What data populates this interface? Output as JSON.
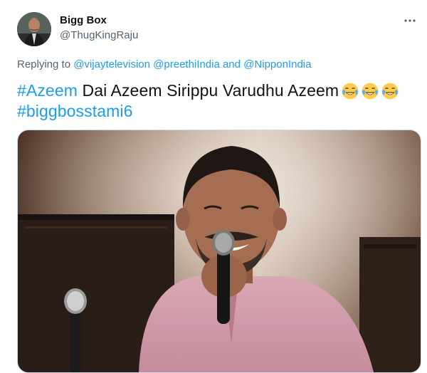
{
  "tweet": {
    "author_name": "Bigg Box",
    "author_handle": "@ThugKingRaju",
    "replying_to_label": "Replying to",
    "mention_1": "@vijaytelevision",
    "mention_2": "@preethiIndia",
    "and_label": "and",
    "mention_3": "@NipponIndia",
    "hashtag_1": "#Azeem",
    "text_body": "Dai Azeem Sirippu Varudhu Azeem",
    "emojis": [
      "face-with-tears-of-joy",
      "face-with-tears-of-joy",
      "face-with-tears-of-joy"
    ],
    "hashtag_2": "#biggbosstami6"
  },
  "colors": {
    "link": "#1d9bf0",
    "secondary_text": "#536471",
    "primary_text": "#0f1419"
  },
  "icons": {
    "more": "more-horizontal-icon"
  }
}
